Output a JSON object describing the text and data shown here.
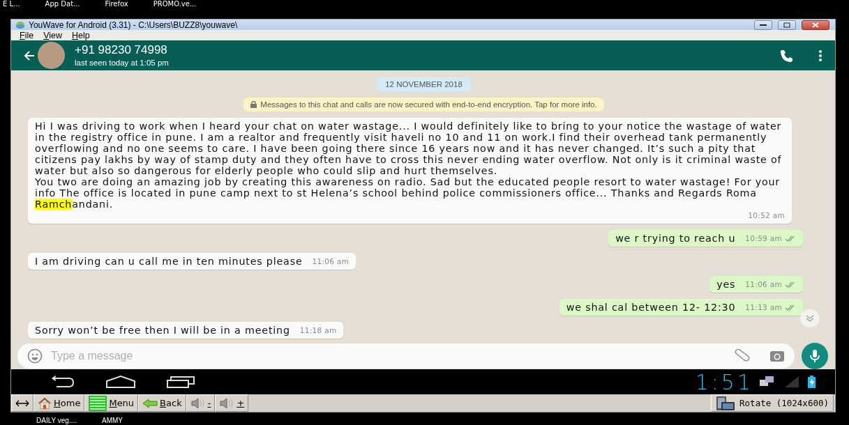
{
  "taskbar_top": [
    "E L...",
    "App Dat...",
    "Firefox",
    "PROMO.ve..."
  ],
  "window": {
    "title": "YouWave for Android (3.31) - C:\\Users\\BUZZ8\\youwave\\"
  },
  "menu": [
    "File",
    "View",
    "Help"
  ],
  "chat_header": {
    "contact": "+91 98230 74998",
    "status": "last seen today at 1:05 pm"
  },
  "date_chip": "12 NOVEMBER 2018",
  "encryption_notice": "Messages to this chat and calls are now secured with end-to-end encryption. Tap for more info.",
  "messages": [
    {
      "kind": "incoming",
      "parts": [
        {
          "text": "Hi I was driving to work when I heard your chat on water wastage... I would definitely like to bring to your notice the wastage of water in the registry office in pune. I am a realtor and frequently visit haveli no 10 and 11 on work.I find their overhead tank permanently overflowing and no one seems to care. I have been going there since 16 years now and it has never changed. It’s such a pity that citizens pay lakhs by way of stamp duty and they often have to cross this never ending water overflow. Not only is it criminal waste of water but also so dangerous for elderly people who could slip and hurt themselves.\nYou two are doing an amazing job by creating this awareness on radio. Sad but the educated people resort to water wastage!  For your info The office is located in pune camp next to st Helena’s school behind police commissioners office... Thanks and Regards Roma ",
          "highlighted": false
        },
        {
          "text": "Ramch",
          "highlighted": true
        },
        {
          "text": "andani.",
          "highlighted": false
        }
      ],
      "time": "10:52 am"
    },
    {
      "kind": "outgoing",
      "parts": [
        {
          "text": "we r trying to reach u",
          "highlighted": false
        }
      ],
      "time": "10:59 am",
      "delivered": true
    },
    {
      "kind": "incoming",
      "parts": [
        {
          "text": "I am driving can u call me in ten minutes please",
          "highlighted": false
        }
      ],
      "time": "11:06 am"
    },
    {
      "kind": "outgoing",
      "parts": [
        {
          "text": "yes",
          "highlighted": false
        }
      ],
      "time": "11:06 am",
      "delivered": true
    },
    {
      "kind": "outgoing",
      "parts": [
        {
          "text": "we shal cal between 12- 12:30",
          "highlighted": false
        }
      ],
      "time": "11:13 am",
      "delivered": true
    },
    {
      "kind": "incoming",
      "parts": [
        {
          "text": "Sorry won’t be free then I will be in a meeting",
          "highlighted": false
        }
      ],
      "time": "11:18 am"
    }
  ],
  "composer": {
    "placeholder": "Type a message"
  },
  "android_status": {
    "time": "1:51"
  },
  "toolbar": [
    {
      "kind": "resize"
    },
    {
      "kind": "home",
      "label": "Home"
    },
    {
      "kind": "menu",
      "label": "Menu"
    },
    {
      "kind": "back",
      "label": "Back"
    },
    {
      "kind": "volume",
      "label": "-"
    },
    {
      "kind": "volume",
      "label": "+"
    }
  ],
  "rotate_button": "Rotate (1024x600)",
  "taskbar_bottom": [
    "DAILY veg....",
    "AMMY"
  ]
}
